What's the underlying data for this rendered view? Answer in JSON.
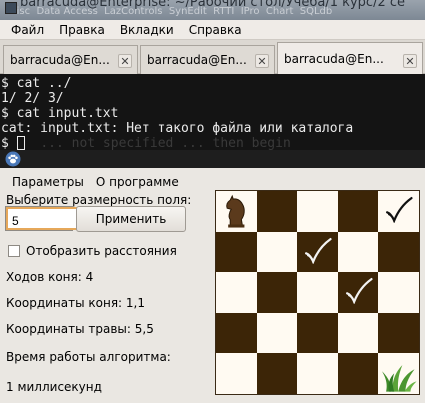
{
  "terminal": {
    "title": "barracuda@Enterprise: ~/Рабочий стол/Учёба/1 курс/2 се",
    "ghost_menu": [
      "Misc",
      "Data Access",
      "LazControls",
      "SynEdit",
      "RTTI",
      "IPro",
      "Chart",
      "SQLdb"
    ],
    "menu": [
      "Файл",
      "Правка",
      "Вкладки",
      "Справка"
    ],
    "tabs": [
      {
        "label": "barracuda@En...",
        "active": false
      },
      {
        "label": "barracuda@En...",
        "active": false
      },
      {
        "label": "barracuda@En...",
        "active": true
      }
    ],
    "lines": [
      "$ cat ../",
      "1/ 2/ 3/",
      "$ cat input.txt",
      "cat: input.txt: Нет такого файла или каталога",
      "$ "
    ],
    "faded_line": "... not specified ... then begin"
  },
  "app": {
    "menu": [
      "Параметры",
      "О программе"
    ],
    "size_label": "Выберите размерность поля:",
    "size_value": "5",
    "apply_button": "Применить",
    "show_distances_label": "Отобразить расстояния",
    "knight_moves": "Ходов коня: 4",
    "knight_coords": "Координаты коня: 1,1",
    "grass_coords": "Координаты травы: 5,5",
    "algo_time_label": "Время работы алгоритма:",
    "algo_time_value": "1 миллисекунд",
    "board": {
      "size": 5,
      "knight": [
        1,
        1
      ],
      "grass": [
        5,
        5
      ],
      "checkmarks": [
        [
          5,
          1
        ],
        [
          3,
          2
        ],
        [
          4,
          3
        ]
      ]
    },
    "colors": {
      "light_square": "#fffaf2",
      "dark_square": "#3c2507",
      "terminal_bg": "#141414"
    }
  }
}
